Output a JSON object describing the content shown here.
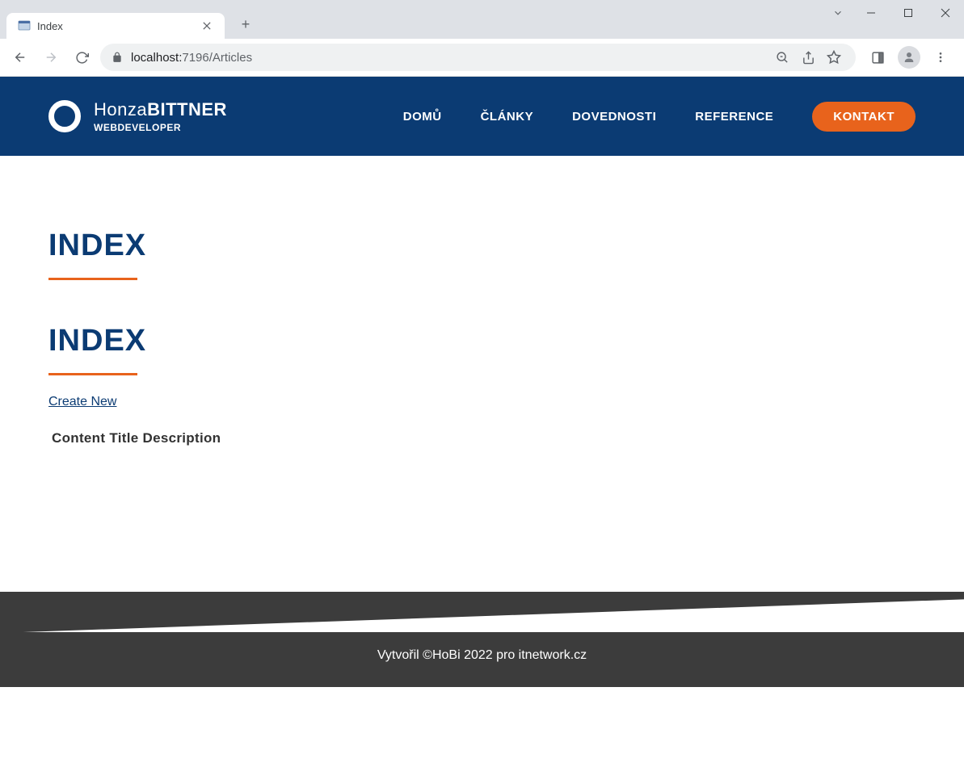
{
  "browser": {
    "tab_title": "Index",
    "url_host": "localhost:",
    "url_port_path": "7196/Articles"
  },
  "header": {
    "logo_first": "Honza",
    "logo_last": "BITTNER",
    "logo_sub": "WEBDEVELOPER",
    "nav": {
      "home": "DOMŮ",
      "articles": "ČLÁNKY",
      "skills": "DOVEDNOSTI",
      "references": "REFERENCE",
      "contact": "KONTAKT"
    }
  },
  "main": {
    "title1": "INDEX",
    "title2": "INDEX",
    "create_link": "Create New",
    "table": {
      "col1": "Content",
      "col2": "Title",
      "col3": "Description"
    }
  },
  "footer": {
    "text": "Vytvořil ©HoBi 2022 pro itnetwork.cz"
  }
}
